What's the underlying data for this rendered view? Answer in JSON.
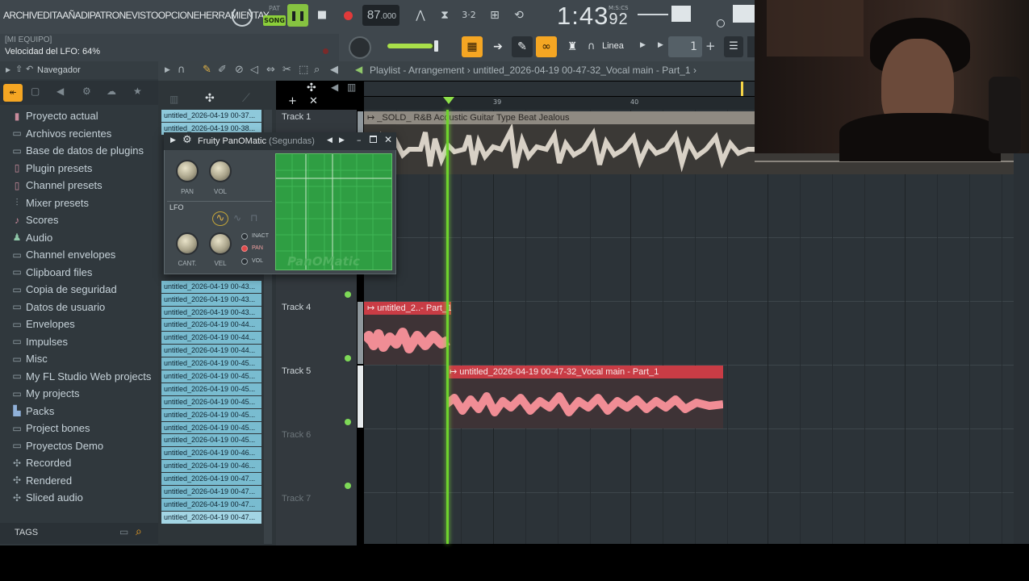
{
  "menu": {
    "items": [
      "ARCHIV",
      "EDITA",
      "AÑADI",
      "PATRON",
      "EVISTO",
      "OPCIONE",
      "HERRAMIENTA",
      "Y"
    ]
  },
  "transport": {
    "pat_label": "PAT",
    "song_label": "SONG",
    "play_icon": "pause-icon",
    "tempo_main": "87",
    "tempo_decimal": ".000",
    "time_main": "1:43",
    "time_cs": "92",
    "time_unit": "M:S:CS"
  },
  "hint": {
    "title": "[MI EQUIPO]",
    "text": "Velocidad del LFO: 64%"
  },
  "controls": {
    "snap_label": "Linea",
    "step_value": "1",
    "master_volume_fraction": 0.93,
    "accent": "#f5a623"
  },
  "browser": {
    "title": "Navegador",
    "items": [
      {
        "icon": "folder-icon",
        "label": "Proyecto actual"
      },
      {
        "icon": "folder-icon",
        "label": "Archivos recientes"
      },
      {
        "icon": "plugin-db-icon",
        "label": "Base de datos de plugins"
      },
      {
        "icon": "folder-icon",
        "label": "Plugin presets"
      },
      {
        "icon": "folder-icon",
        "label": "Channel presets"
      },
      {
        "icon": "mixer-icon",
        "label": "Mixer presets"
      },
      {
        "icon": "note-icon",
        "label": "Scores"
      },
      {
        "icon": "audio-icon",
        "label": "Audio"
      },
      {
        "icon": "folder-icon",
        "label": "Channel envelopes"
      },
      {
        "icon": "folder-icon",
        "label": "Clipboard files"
      },
      {
        "icon": "folder-icon",
        "label": "Copia de seguridad"
      },
      {
        "icon": "folder-icon",
        "label": "Datos de usuario"
      },
      {
        "icon": "folder-icon",
        "label": "Envelopes"
      },
      {
        "icon": "folder-icon",
        "label": "Impulses"
      },
      {
        "icon": "folder-icon",
        "label": "Misc"
      },
      {
        "icon": "folder-icon",
        "label": "My FL Studio Web projects"
      },
      {
        "icon": "folder-icon",
        "label": "My projects"
      },
      {
        "icon": "packs-icon",
        "label": "Packs"
      },
      {
        "icon": "folder-icon",
        "label": "Project bones"
      },
      {
        "icon": "folder-icon",
        "label": "Proyectos Demo"
      },
      {
        "icon": "recorded-icon",
        "label": "Recorded"
      },
      {
        "icon": "rendered-icon",
        "label": "Rendered"
      },
      {
        "icon": "sliced-icon",
        "label": "Sliced audio"
      }
    ],
    "tags_label": "TAGS"
  },
  "picker": {
    "items": [
      "untitled_2026-04-19 00-37...",
      "untitled_2026-04-19 00-38...",
      "untitled_2026-04-19 00-43...",
      "untitled_2026-04-19 00-43...",
      "untitled_2026-04-19 00-43...",
      "untitled_2026-04-19 00-44...",
      "untitled_2026-04-19 00-44...",
      "untitled_2026-04-19 00-44...",
      "untitled_2026-04-19 00-45...",
      "untitled_2026-04-19 00-45...",
      "untitled_2026-04-19 00-45...",
      "untitled_2026-04-19 00-45...",
      "untitled_2026-04-19 00-45...",
      "untitled_2026-04-19 00-45...",
      "untitled_2026-04-19 00-45...",
      "untitled_2026-04-19 00-46...",
      "untitled_2026-04-19 00-46...",
      "untitled_2026-04-19 00-47...",
      "untitled_2026-04-19 00-47...",
      "untitled_2026-04-19 00-47...",
      "untitled_2026-04-19 00-47..."
    ]
  },
  "playlist": {
    "title": "Playlist - Arrangement",
    "separator": "›",
    "pattern": "untitled_2026-04-19 00-47-32_Vocal main - Part_1",
    "bar_numbers": [
      "39",
      "40"
    ],
    "tracks": [
      {
        "name": "Track 1",
        "dim": false
      },
      {
        "name": "Track 4",
        "dim": false
      },
      {
        "name": "Track 5",
        "dim": false
      },
      {
        "name": "Track 6",
        "dim": true
      },
      {
        "name": "Track 7",
        "dim": true
      }
    ],
    "clips": {
      "clip1": "_SOLD_ R&B Acoustic Guitar Type Beat  Jealous",
      "clip4": "untitled_2..- Part_1",
      "clip5": "untitled_2026-04-19 00-47-32_Vocal main - Part_1"
    },
    "colors": {
      "clip_red": "#c93c45",
      "clip_wave": "#f08d95",
      "guitar_clip": "#8f8a82",
      "playhead": "#6fd32d"
    }
  },
  "plugin": {
    "title": "Fruity PanOMatic",
    "subtitle": "(Segundas)",
    "knobs": {
      "pan": "PAN",
      "vol": "VOL",
      "cant": "CANT.",
      "vel": "VEL"
    },
    "lfo_label": "LFO",
    "radio": {
      "inact": "INACT",
      "pan": "PAN",
      "vol": "VOL"
    },
    "selected_target": "PAN",
    "logo_text": "PanOMatic"
  }
}
